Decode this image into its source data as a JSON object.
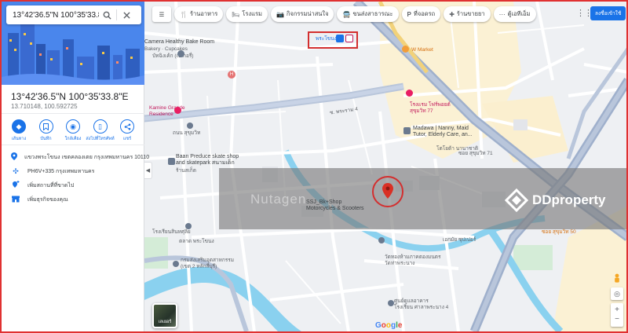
{
  "search": {
    "query": "13°42'36.5\"N 100°35'33.8\"E"
  },
  "place": {
    "title": "13°42'36.5\"N 100°35'33.8\"E",
    "coords": "13.710148, 100.592725"
  },
  "actions": [
    {
      "label": "เส้นทาง",
      "icon": "directions-icon"
    },
    {
      "label": "บันทึก",
      "icon": "bookmark-icon"
    },
    {
      "label": "ใกล้เคียง",
      "icon": "nearby-icon"
    },
    {
      "label": "ส่งไปที่โทรศัพท์",
      "icon": "phone-icon"
    },
    {
      "label": "แชร์",
      "icon": "share-icon"
    }
  ],
  "info": [
    {
      "text": "แขวงพระโขนง เขตคลองเตย กรุงเทพมหานคร 10110",
      "icon": "location-pin-icon"
    },
    {
      "text": "PH6V+335 กรุงเทพมหานคร",
      "icon": "plus-code-icon"
    },
    {
      "text": "เพิ่มสถานที่ที่ขาดไป",
      "icon": "add-place-icon"
    },
    {
      "text": "เพิ่มธุรกิจของคุณ",
      "icon": "business-icon"
    }
  ],
  "chips": [
    {
      "label": "ร้านอาหาร",
      "icon": "restaurant-icon",
      "glyph": "🍴"
    },
    {
      "label": "โรงแรม",
      "icon": "hotel-icon",
      "glyph": "🛏"
    },
    {
      "label": "กิจกรรมน่าสนใจ",
      "icon": "camera-icon",
      "glyph": "📷"
    },
    {
      "label": "ขนส่งสาธารณะ",
      "icon": "transit-icon",
      "glyph": "🚍"
    },
    {
      "label": "ที่จอดรถ",
      "icon": "parking-icon",
      "glyph": "P"
    },
    {
      "label": "ร้านขายยา",
      "icon": "pharmacy-icon",
      "glyph": "✚"
    },
    {
      "label": "ตู้เอทีเอ็ม",
      "icon": "more-icon",
      "glyph": "⋯"
    }
  ],
  "signin_label": "ลงชื่อเข้าใช้",
  "map_labels": {
    "bakery": "Camera Healthy Bake Room",
    "bakery_sub": "Bakery · Cupcakes",
    "bakery_thai": "บัทฉิงเค้ก (เบเกอรี่)",
    "residence": "Kamine Grande\nResidence",
    "station": "พระโขนง",
    "w_market": "W Market",
    "hotel_pink": "โรงแรม โฟร์พอยต์\nสุขุมวิท 77",
    "madawa": "Madawa | Nanny, Maid\nTutor, Elderly Care, an...",
    "madawa_thai": "โตโยต้า นานาชาติ",
    "skate": "Baan Preduce skate shop\nand skatepark สนามเด็ก",
    "skate_sub": "ร้านสเก็ต",
    "bike_shop": "SSJ_Bk+Shop\nMotorcycles & Scooters",
    "temple": "วัดทองห้ามภาคตองมนตร\nวัดท่าพระนาง",
    "school": "ศูนย์ดูแลอาคาร\nโรงเรียน ศาลาพระนาง 4",
    "office": "กรมส่งเสริมอุตสาหกรรม\n(เขต 2 หลักสี่บุรี)",
    "market": "ตลาด พระโขนง",
    "school2": "โรงเรียนสินหศุลิย",
    "soi50": "ซอย สุขุมวิท 50",
    "road_soi4": "ซ. พระราม 4",
    "road_bottom": "เอกมัย ซุปเปอร์",
    "sukhumvit": "ซอย สุขุมวิท 71",
    "road_right": "ถนน สุขุมวิท"
  },
  "watermark": {
    "ghost": "Nutagen",
    "brand": "DDproperty"
  },
  "layers_label": "เลเยอร์",
  "google": [
    "G",
    "o",
    "o",
    "g",
    "l",
    "e"
  ]
}
